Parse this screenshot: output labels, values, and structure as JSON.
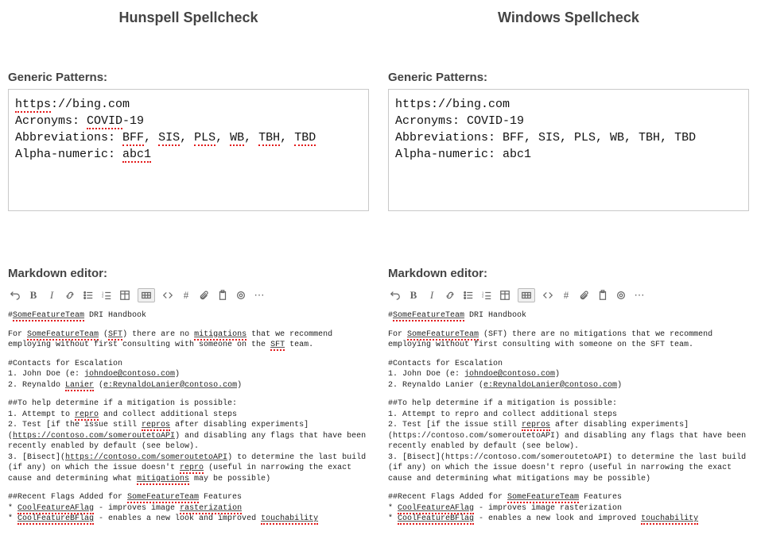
{
  "columns": [
    {
      "title": "Hunspell Spellcheck",
      "generic_heading": "Generic Patterns:",
      "patterns": {
        "url": [
          {
            "t": "https",
            "err": true
          },
          {
            "t": "://bing.com",
            "err": false
          }
        ],
        "acronyms_label": "Acronyms: ",
        "acronyms": [
          {
            "t": "COVID",
            "err": true
          },
          {
            "t": "-19",
            "err": false
          }
        ],
        "abbrev_label": "Abbreviations: ",
        "abbrev": [
          {
            "t": "BFF",
            "err": true
          },
          {
            "t": ", ",
            "err": false
          },
          {
            "t": "SIS",
            "err": true
          },
          {
            "t": ", ",
            "err": false
          },
          {
            "t": "PLS",
            "err": true
          },
          {
            "t": ", ",
            "err": false
          },
          {
            "t": "WB",
            "err": true
          },
          {
            "t": ", ",
            "err": false
          },
          {
            "t": "TBH",
            "err": true
          },
          {
            "t": ", ",
            "err": false
          },
          {
            "t": "TBD",
            "err": true
          }
        ],
        "alpha_label": "Alpha-numeric: ",
        "alpha": [
          {
            "t": "abc1",
            "err": true
          }
        ]
      },
      "markdown_heading": "Markdown editor:",
      "markdown": [
        [
          {
            "t": "#",
            "u": false,
            "e": false
          },
          {
            "t": "SomeFeatureTeam",
            "u": true,
            "e": true
          },
          {
            "t": " DRI Handbook",
            "u": false,
            "e": false
          }
        ],
        [],
        [
          {
            "t": "For ",
            "u": false,
            "e": false
          },
          {
            "t": "SomeFeatureTeam",
            "u": true,
            "e": true
          },
          {
            "t": " (",
            "u": false,
            "e": false
          },
          {
            "t": "SFT",
            "u": true,
            "e": true
          },
          {
            "t": ") there are no ",
            "u": false,
            "e": false
          },
          {
            "t": "mitigations",
            "u": true,
            "e": true
          },
          {
            "t": " that we recommend employing without first consulting with someone on the ",
            "u": false,
            "e": false
          },
          {
            "t": "SFT",
            "u": true,
            "e": true
          },
          {
            "t": " team.",
            "u": false,
            "e": false
          }
        ],
        [],
        [
          {
            "t": "#Contacts for Escalation",
            "u": false,
            "e": false
          }
        ],
        [
          {
            "t": "1. John Doe (e: ",
            "u": false,
            "e": false
          },
          {
            "t": "johndoe@contoso.com",
            "u": true,
            "e": false
          },
          {
            "t": ")",
            "u": false,
            "e": false
          }
        ],
        [
          {
            "t": "2. Reynaldo ",
            "u": false,
            "e": false
          },
          {
            "t": "Lanier",
            "u": true,
            "e": true
          },
          {
            "t": " (",
            "u": false,
            "e": false
          },
          {
            "t": "e:ReynaldoLanier@contoso.com",
            "u": true,
            "e": false
          },
          {
            "t": ")",
            "u": false,
            "e": false
          }
        ],
        [],
        [
          {
            "t": "##To help determine if a mitigation is possible:",
            "u": false,
            "e": false
          }
        ],
        [
          {
            "t": "1. Attempt to ",
            "u": false,
            "e": false
          },
          {
            "t": "repro",
            "u": true,
            "e": true
          },
          {
            "t": " and collect additional steps",
            "u": false,
            "e": false
          }
        ],
        [
          {
            "t": "2. Test [if the issue still ",
            "u": false,
            "e": false
          },
          {
            "t": "repros",
            "u": true,
            "e": true
          },
          {
            "t": " after disabling experiments](",
            "u": false,
            "e": false
          },
          {
            "t": "https://contoso.com/someroutetoAPI",
            "u": true,
            "e": false
          },
          {
            "t": ") and disabling any flags that have been recently enabled by default (see below).",
            "u": false,
            "e": false
          }
        ],
        [
          {
            "t": "3. [Bisect](",
            "u": false,
            "e": false
          },
          {
            "t": "https://contoso.com/someroutetoAPI",
            "u": true,
            "e": false
          },
          {
            "t": ") to determine the last build (if any) on which the issue doesn't ",
            "u": false,
            "e": false
          },
          {
            "t": "repro",
            "u": true,
            "e": true
          },
          {
            "t": " (useful in narrowing the exact cause and determining what ",
            "u": false,
            "e": false
          },
          {
            "t": "mitigations",
            "u": true,
            "e": true
          },
          {
            "t": " may be possible)",
            "u": false,
            "e": false
          }
        ],
        [],
        [
          {
            "t": "##Recent Flags Added for ",
            "u": false,
            "e": false
          },
          {
            "t": "SomeFeatureTeam",
            "u": true,
            "e": true
          },
          {
            "t": " Features",
            "u": false,
            "e": false
          }
        ],
        [
          {
            "t": "* ",
            "u": false,
            "e": false
          },
          {
            "t": "CoolFeatureAFlag",
            "u": true,
            "e": true
          },
          {
            "t": " - improves image ",
            "u": false,
            "e": false
          },
          {
            "t": "rasterization",
            "u": true,
            "e": true
          }
        ],
        [
          {
            "t": "* ",
            "u": false,
            "e": false
          },
          {
            "t": "CoolFeatureBFlag",
            "u": true,
            "e": true
          },
          {
            "t": " - enables a new look and improved ",
            "u": false,
            "e": false
          },
          {
            "t": "touchability",
            "u": true,
            "e": true
          }
        ]
      ]
    },
    {
      "title": "Windows Spellcheck",
      "generic_heading": "Generic Patterns:",
      "patterns": {
        "url": [
          {
            "t": "https://bing.com",
            "err": false
          }
        ],
        "acronyms_label": "Acronyms: ",
        "acronyms": [
          {
            "t": "COVID-19",
            "err": false
          }
        ],
        "abbrev_label": "Abbreviations: ",
        "abbrev": [
          {
            "t": "BFF, SIS, PLS, WB, TBH, TBD",
            "err": false
          }
        ],
        "alpha_label": "Alpha-numeric: ",
        "alpha": [
          {
            "t": "abc1",
            "err": false
          }
        ]
      },
      "markdown_heading": "Markdown editor:",
      "markdown": [
        [
          {
            "t": "#",
            "u": false,
            "e": false
          },
          {
            "t": "SomeFeatureTeam",
            "u": true,
            "e": true
          },
          {
            "t": " DRI Handbook",
            "u": false,
            "e": false
          }
        ],
        [],
        [
          {
            "t": "For ",
            "u": false,
            "e": false
          },
          {
            "t": "SomeFeatureTeam",
            "u": true,
            "e": true
          },
          {
            "t": " (SFT) there are no mitigations that we recommend employing without first consulting with someone on the SFT team.",
            "u": false,
            "e": false
          }
        ],
        [],
        [
          {
            "t": "#Contacts for Escalation",
            "u": false,
            "e": false
          }
        ],
        [
          {
            "t": "1. John Doe (e: ",
            "u": false,
            "e": false
          },
          {
            "t": "johndoe@contoso.com",
            "u": true,
            "e": false
          },
          {
            "t": ")",
            "u": false,
            "e": false
          }
        ],
        [
          {
            "t": "2. Reynaldo Lanier (",
            "u": false,
            "e": false
          },
          {
            "t": "e:ReynaldoLanier@contoso.com",
            "u": true,
            "e": false
          },
          {
            "t": ")",
            "u": false,
            "e": false
          }
        ],
        [],
        [
          {
            "t": "##To help determine if a mitigation is possible:",
            "u": false,
            "e": false
          }
        ],
        [
          {
            "t": "1. Attempt to repro and collect additional steps",
            "u": false,
            "e": false
          }
        ],
        [
          {
            "t": "2. Test [if the issue still ",
            "u": false,
            "e": false
          },
          {
            "t": "repros",
            "u": true,
            "e": true
          },
          {
            "t": " after disabling experiments](https://contoso.com/someroutetoAPI) and disabling any flags that have been recently enabled by default (see below).",
            "u": false,
            "e": false
          }
        ],
        [
          {
            "t": "3. [Bisect](https://contoso.com/someroutetoAPI) to determine the last build (if any) on which the issue doesn't repro (useful in narrowing the exact cause and determining what mitigations may be possible)",
            "u": false,
            "e": false
          }
        ],
        [],
        [
          {
            "t": "##Recent Flags Added for ",
            "u": false,
            "e": false
          },
          {
            "t": "SomeFeatureTeam",
            "u": true,
            "e": true
          },
          {
            "t": " Features",
            "u": false,
            "e": false
          }
        ],
        [
          {
            "t": "* ",
            "u": false,
            "e": false
          },
          {
            "t": "CoolFeatureAFlag",
            "u": true,
            "e": true
          },
          {
            "t": " - improves image rasterization",
            "u": false,
            "e": false
          }
        ],
        [
          {
            "t": "* ",
            "u": false,
            "e": false
          },
          {
            "t": "CoolFeatureBFlag",
            "u": true,
            "e": true
          },
          {
            "t": " - enables a new look and improved ",
            "u": false,
            "e": false
          },
          {
            "t": "touchability",
            "u": true,
            "e": true
          }
        ]
      ]
    }
  ],
  "toolbar": [
    {
      "name": "undo-icon"
    },
    {
      "name": "bold-icon",
      "glyph": "B",
      "bold": true
    },
    {
      "name": "italic-icon",
      "glyph": "I",
      "italic": true
    },
    {
      "name": "link-icon"
    },
    {
      "name": "bullet-list-icon"
    },
    {
      "name": "numbered-list-icon"
    },
    {
      "name": "table-icon"
    },
    {
      "name": "grid-icon",
      "selected": true
    },
    {
      "name": "code-icon"
    },
    {
      "name": "hash-icon",
      "glyph": "#"
    },
    {
      "name": "attachment-icon"
    },
    {
      "name": "clipboard-icon"
    },
    {
      "name": "mention-icon"
    },
    {
      "name": "more-icon",
      "glyph": "⋯"
    }
  ]
}
